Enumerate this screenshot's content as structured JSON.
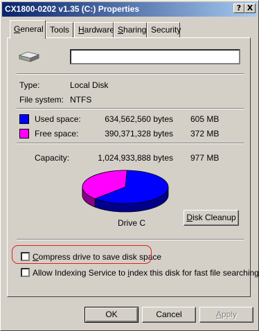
{
  "window": {
    "title": "CX1800-0202 v1.35 (C:) Properties",
    "help_label": "?",
    "close_label": "X"
  },
  "tabs": [
    {
      "label_pre": "",
      "accel": "G",
      "label_post": "eneral"
    },
    {
      "label_pre": "T",
      "accel": "",
      "label_post": "ools"
    },
    {
      "label_pre": "",
      "accel": "H",
      "label_post": "ardware"
    },
    {
      "label_pre": "",
      "accel": "S",
      "label_post": "haring"
    },
    {
      "label_pre": "Sec",
      "accel": "",
      "label_post": "urity"
    }
  ],
  "drive": {
    "icon": "hard-drive-icon",
    "name_value": "",
    "type_label": "Type:",
    "type_value": "Local Disk",
    "fs_label": "File system:",
    "fs_value": "NTFS",
    "used_label": "Used space:",
    "used_bytes": "634,562,560 bytes",
    "used_human": "605 MB",
    "free_label": "Free space:",
    "free_bytes": "390,371,328 bytes",
    "free_human": "372 MB",
    "capacity_label": "Capacity:",
    "capacity_bytes": "1,024,933,888 bytes",
    "capacity_human": "977 MB",
    "drive_label": "Drive C",
    "used_fraction": 0.619,
    "used_color": "#0000ff",
    "free_color": "#ff00ff"
  },
  "buttons": {
    "disk_cleanup": {
      "accel": "D",
      "rest": "isk Cleanup"
    },
    "ok": "OK",
    "cancel": "Cancel",
    "apply": {
      "accel": "A",
      "rest": "pply"
    }
  },
  "options": {
    "compress": {
      "accel": "C",
      "rest": "ompress drive to save disk space",
      "checked": false
    },
    "index_pre": "Allow Indexing Service to ",
    "index_accel": "i",
    "index_post": "ndex this disk for fast file searching",
    "index_checked": false
  }
}
